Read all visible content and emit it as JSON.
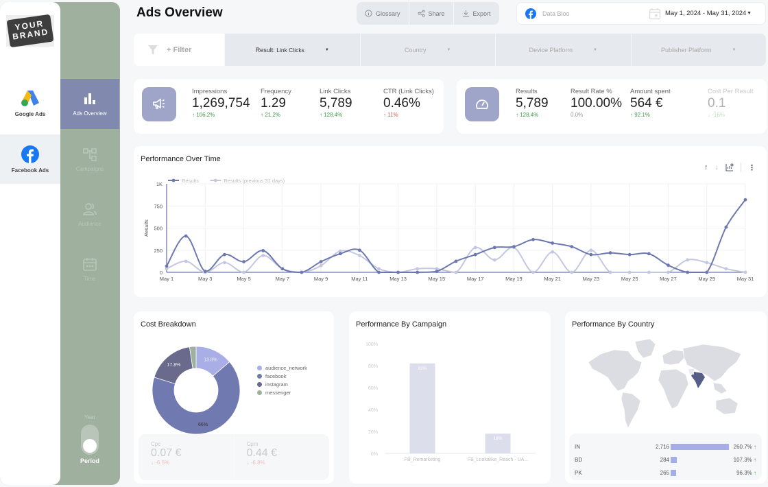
{
  "brand": {
    "line1": "YOUR",
    "line2": "BRAND"
  },
  "sources": [
    {
      "label": "Google Ads",
      "icon": "google-ads-icon"
    },
    {
      "label": "Facebook Ads",
      "icon": "facebook-icon"
    }
  ],
  "nav": [
    {
      "label": "Ads Overview",
      "icon": "bar-chart-icon",
      "active": true
    },
    {
      "label": "Campaigns",
      "icon": "hierarchy-icon",
      "active": false
    },
    {
      "label": "Audience",
      "icon": "users-icon",
      "active": false
    },
    {
      "label": "Time",
      "icon": "calendar-icon",
      "active": false
    }
  ],
  "period_toggle": {
    "top_label": "Year",
    "bottom_label": "Period"
  },
  "header": {
    "title": "Ads Overview",
    "buttons": [
      {
        "label": "Glossary",
        "icon": "info-icon"
      },
      {
        "label": "Share",
        "icon": "share-icon"
      },
      {
        "label": "Export",
        "icon": "download-icon"
      }
    ],
    "data_source": "Data Bloo",
    "date_range": "May 1, 2024 - May 31, 2024"
  },
  "filters": {
    "add_label": "+ Filter",
    "dropdowns": [
      {
        "prefix": "Result:",
        "value": "Link Clicks",
        "active": true
      },
      {
        "prefix": "",
        "value": "Country",
        "active": false
      },
      {
        "prefix": "",
        "value": "Device Platform",
        "active": false
      },
      {
        "prefix": "",
        "value": "Publisher Platform",
        "active": false
      }
    ]
  },
  "kpis_left": [
    {
      "label": "Impressions",
      "value": "1,269,754",
      "change": "106.2%",
      "dir": "up"
    },
    {
      "label": "Frequency",
      "value": "1.29",
      "change": "21.2%",
      "dir": "up"
    },
    {
      "label": "Link Clicks",
      "value": "5,789",
      "change": "128.4%",
      "dir": "up"
    },
    {
      "label": "CTR (Link Clicks)",
      "value": "0.46%",
      "change": "11%",
      "dir": "down-bad"
    }
  ],
  "kpis_right": [
    {
      "label": "Results",
      "value": "5,789",
      "change": "128.4%",
      "dir": "up"
    },
    {
      "label": "Result Rate %",
      "value": "100.00%",
      "change": "0.0%",
      "dir": "neutral"
    },
    {
      "label": "Amount spent",
      "value": "564 €",
      "change": "92.1%",
      "dir": "up"
    },
    {
      "label": "Cost Per Result",
      "value": "0.1",
      "change": "-16%",
      "dir": "faded"
    }
  ],
  "performance_over_time": {
    "title": "Performance Over Time",
    "tools": [
      "sort-ascending-icon",
      "sort-descending-icon",
      "chart-settings-icon",
      "more-vert-icon"
    ]
  },
  "cost_breakdown": {
    "title": "Cost Breakdown",
    "cpc": {
      "label": "Cpc",
      "value": "0.07 €",
      "change": "-6.5%"
    },
    "cpm": {
      "label": "Cpm",
      "value": "0.44 €",
      "change": "-6.8%"
    }
  },
  "performance_by_campaign": {
    "title": "Performance By Campaign"
  },
  "performance_by_country": {
    "title": "Performance By Country",
    "rows": [
      {
        "code": "IN",
        "value": "2,716",
        "raw": 2716,
        "change": "260.7%"
      },
      {
        "code": "BD",
        "value": "284",
        "raw": 284,
        "change": "107.3%"
      },
      {
        "code": "PK",
        "value": "265",
        "raw": 265,
        "change": "96.3%"
      }
    ]
  },
  "colors": {
    "accent": "#6e78b0",
    "accent_light": "#c4c7e0",
    "sidebar": "#9fb09f",
    "up": "#3c9a4c",
    "down": "#e35252"
  },
  "chart_data": [
    {
      "type": "line",
      "title": "Performance Over Time",
      "xlabel": "",
      "ylabel": "Results",
      "ylim": [
        0,
        1000
      ],
      "yticks": [
        "0",
        "250",
        "500",
        "750",
        "1K"
      ],
      "xticks": [
        "May 1",
        "May 3",
        "May 5",
        "May 7",
        "May 9",
        "May 11",
        "May 13",
        "May 15",
        "May 17",
        "May 19",
        "May 21",
        "May 23",
        "May 25",
        "May 27",
        "May 29",
        "May 31"
      ],
      "x": [
        "May 1",
        "May 2",
        "May 3",
        "May 4",
        "May 5",
        "May 6",
        "May 7",
        "May 8",
        "May 9",
        "May 10",
        "May 11",
        "May 12",
        "May 13",
        "May 14",
        "May 15",
        "May 16",
        "May 17",
        "May 18",
        "May 19",
        "May 20",
        "May 21",
        "May 22",
        "May 23",
        "May 24",
        "May 25",
        "May 26",
        "May 27",
        "May 28",
        "May 29",
        "May 30",
        "May 31"
      ],
      "legend": "top-left",
      "grid": true,
      "series": [
        {
          "name": "Results",
          "color": "#6e78b0",
          "values": [
            70,
            410,
            10,
            200,
            120,
            245,
            40,
            0,
            120,
            210,
            250,
            0,
            0,
            0,
            10,
            125,
            200,
            280,
            290,
            370,
            330,
            290,
            200,
            220,
            200,
            210,
            80,
            0,
            0,
            510,
            820
          ]
        },
        {
          "name": "Results (previous 31 days)",
          "color": "#c4c7e0",
          "values": [
            40,
            125,
            0,
            110,
            0,
            190,
            40,
            0,
            75,
            240,
            190,
            40,
            0,
            40,
            40,
            0,
            280,
            140,
            280,
            0,
            230,
            0,
            250,
            0,
            0,
            0,
            0,
            140,
            110,
            40,
            0
          ]
        }
      ]
    },
    {
      "type": "pie",
      "title": "Cost Breakdown",
      "categories": [
        "audience_network",
        "facebook",
        "instagram",
        "messenger"
      ],
      "values": [
        13.8,
        66.0,
        17.8,
        2.4
      ],
      "labels": [
        "13.8%",
        "66%",
        "17.8%",
        ""
      ],
      "colors": [
        "#a9aee6",
        "#7079b0",
        "#6a6b8c",
        "#9fb09f"
      ],
      "legend": "right"
    },
    {
      "type": "bar",
      "title": "Performance By Campaign",
      "categories": [
        "FB_Remarketing",
        "FB_Lookalike_Reach - UA..."
      ],
      "values": [
        82,
        18
      ],
      "labels": [
        "82%",
        "18%"
      ],
      "yticks": [
        "0%",
        "20%",
        "40%",
        "60%",
        "80%",
        "100%"
      ],
      "ylim": [
        0,
        100
      ],
      "color": "#dcdeeb"
    }
  ]
}
